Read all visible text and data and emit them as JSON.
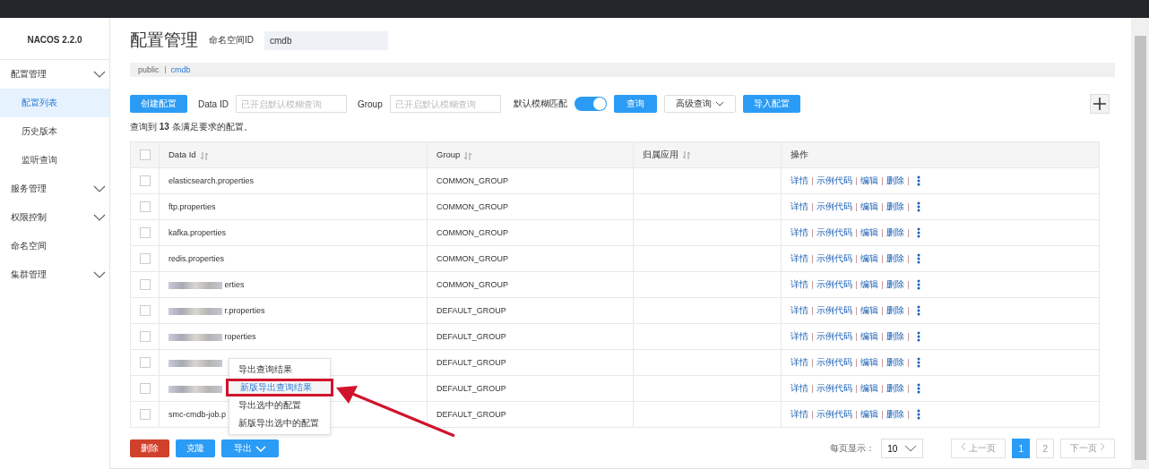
{
  "sidebar": {
    "title": "NACOS 2.2.0",
    "items": [
      {
        "label": "配置管理",
        "kind": "group",
        "selected": false,
        "children": [
          {
            "label": "配置列表",
            "selected": true
          },
          {
            "label": "历史版本",
            "selected": false
          },
          {
            "label": "监听查询",
            "selected": false
          }
        ]
      },
      {
        "label": "服务管理",
        "kind": "group",
        "selected": false
      },
      {
        "label": "权限控制",
        "kind": "group",
        "selected": false
      },
      {
        "label": "命名空间",
        "kind": "link",
        "selected": false
      },
      {
        "label": "集群管理",
        "kind": "group",
        "selected": false
      }
    ]
  },
  "page": {
    "title": "配置管理",
    "namespace_label": "命名空间ID",
    "namespace_value": "cmdb",
    "breadcrumb": [
      {
        "label": "public",
        "selected": false
      },
      {
        "label": "cmdb",
        "selected": true
      }
    ]
  },
  "toolbar": {
    "create_button": "创建配置",
    "data_id_label": "Data ID",
    "data_id_placeholder": "已开启默认模糊查询",
    "group_label": "Group",
    "group_placeholder": "已开启默认模糊查询",
    "fuzzy_label": "默认模糊匹配",
    "fuzzy_on": true,
    "search_button": "查询",
    "advanced_button": "高级查询",
    "import_button": "导入配置"
  },
  "result_summary": "查询到 **13** 条满足要求的配置。",
  "table": {
    "all_checked": false,
    "columns": [
      {
        "label": "Data Id",
        "sortable": true
      },
      {
        "label": "Group",
        "sortable": true
      },
      {
        "label": "归属应用",
        "sortable": true
      },
      {
        "label": "操作"
      }
    ],
    "rows": [
      {
        "checked": false,
        "redacted": false,
        "data_id": "elasticsearch.properties",
        "group": "COMMON_GROUP",
        "actions": [
          "详情",
          "示例代码",
          "编辑",
          "删除"
        ]
      },
      {
        "checked": false,
        "redacted": false,
        "data_id": "ftp.properties",
        "group": "COMMON_GROUP",
        "actions": [
          "详情",
          "示例代码",
          "编辑",
          "删除"
        ]
      },
      {
        "checked": false,
        "redacted": false,
        "data_id": "kafka.properties",
        "group": "COMMON_GROUP",
        "actions": [
          "详情",
          "示例代码",
          "编辑",
          "删除"
        ]
      },
      {
        "checked": false,
        "redacted": false,
        "data_id": "redis.properties",
        "group": "COMMON_GROUP",
        "actions": [
          "详情",
          "示例代码",
          "编辑",
          "删除"
        ]
      },
      {
        "checked": false,
        "redacted": true,
        "data_id": "erties",
        "group": "COMMON_GROUP",
        "actions": [
          "详情",
          "示例代码",
          "编辑",
          "删除"
        ]
      },
      {
        "checked": false,
        "redacted": true,
        "data_id": "r.properties",
        "group": "DEFAULT_GROUP",
        "actions": [
          "详情",
          "示例代码",
          "编辑",
          "删除"
        ]
      },
      {
        "checked": false,
        "redacted": true,
        "data_id": "roperties",
        "group": "DEFAULT_GROUP",
        "actions": [
          "详情",
          "示例代码",
          "编辑",
          "删除"
        ]
      },
      {
        "checked": false,
        "redacted": true,
        "group": "DEFAULT_GROUP",
        "actions": [
          "详情",
          "示例代码",
          "编辑",
          "删除"
        ]
      },
      {
        "checked": false,
        "redacted": true,
        "group": "DEFAULT_GROUP",
        "actions": [
          "详情",
          "示例代码",
          "编辑",
          "删除"
        ]
      },
      {
        "checked": false,
        "redacted": false,
        "data_id": "smc-cmdb-job.p",
        "group": "DEFAULT_GROUP",
        "actions": [
          "详情",
          "示例代码",
          "编辑",
          "删除"
        ]
      }
    ]
  },
  "bottom": {
    "delete_button": "删除",
    "clone_button": "克隆",
    "export_button": "导出",
    "export_menu": [
      {
        "label": "导出查询结果",
        "selected": false,
        "highlighted": false
      },
      {
        "label": "新版导出查询结果",
        "selected": true,
        "highlighted": true
      },
      {
        "label": "导出选中的配置",
        "selected": false,
        "highlighted": false
      },
      {
        "label": "新版导出选中的配置",
        "selected": false,
        "highlighted": false
      }
    ],
    "page_size_label": "每页显示：",
    "page_size": "10",
    "prev_button": "上一页",
    "pages": [
      {
        "label": "1",
        "selected": true
      },
      {
        "label": "2",
        "selected": false
      }
    ],
    "next_button": "下一页"
  }
}
